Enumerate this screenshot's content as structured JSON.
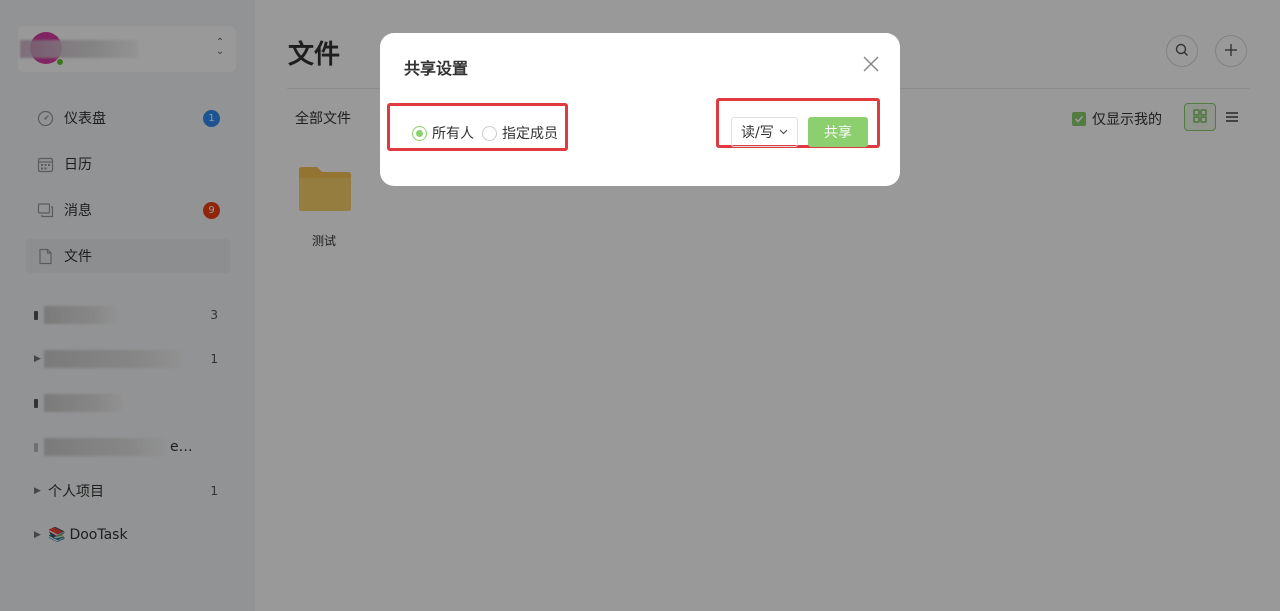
{
  "sidebar": {
    "nav": [
      {
        "label": "仪表盘",
        "icon": "dashboard-icon",
        "badge": "1",
        "badge_color": "#2d8cf0"
      },
      {
        "label": "日历",
        "icon": "calendar-icon",
        "badge": null
      },
      {
        "label": "消息",
        "icon": "message-icon",
        "badge": "9",
        "badge_color": "#ed4014"
      },
      {
        "label": "文件",
        "icon": "file-icon",
        "badge": null,
        "active": true
      }
    ],
    "projects": [
      {
        "name": "",
        "count": "3"
      },
      {
        "name": "",
        "count": "1"
      },
      {
        "name": "",
        "count": ""
      },
      {
        "name": "e…",
        "count": ""
      },
      {
        "name": "个人项目",
        "count": "1"
      },
      {
        "name": "DooTask",
        "count": "",
        "emoji": "📚"
      }
    ]
  },
  "main": {
    "title": "文件",
    "breadcrumb": "全部文件",
    "only_mine_label": "仅显示我的",
    "only_mine_checked": true,
    "files": [
      {
        "name": "测试",
        "type": "folder"
      }
    ]
  },
  "modal": {
    "title": "共享设置",
    "radio_options": [
      {
        "label": "所有人",
        "checked": true
      },
      {
        "label": "指定成员",
        "checked": false
      }
    ],
    "permission": "读/写",
    "share_label": "共享"
  },
  "colors": {
    "accent": "#8bcf6f",
    "highlight": "#e0393e",
    "badge_blue": "#2d8cf0",
    "badge_red": "#ed4014",
    "folder": "#f5c150"
  }
}
